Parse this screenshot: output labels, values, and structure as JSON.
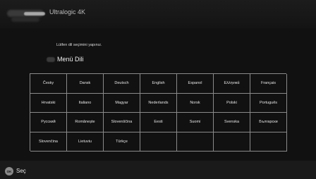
{
  "header": {
    "title": "Ultralogic 4K",
    "logo_icon": "brand-logo"
  },
  "prompt": "Lütfen dil seçimini yapınız.",
  "section": {
    "title": "Menü Dili",
    "icon": "menu-icon"
  },
  "languages": [
    [
      "Česky",
      "Dansk",
      "Deutsch",
      "English",
      "Espanol",
      "Ελληνικά",
      "Français"
    ],
    [
      "Hrvatski",
      "Italiano",
      "Magyar",
      "Nederlands",
      "Norsk",
      "Polski",
      "Português"
    ],
    [
      "Русский",
      "Românește",
      "Slovenščina",
      "Eesti",
      "Suomi",
      "Svenska",
      "Български"
    ],
    [
      "Slovenčina",
      "Lietuviu",
      "Türkçe",
      "",
      "",
      "",
      ""
    ]
  ],
  "footer": {
    "ok_button": "OK",
    "ok_label": "Seç"
  },
  "colors": {
    "background": "#111111",
    "grid_border": "#8a8a8a",
    "text": "#e6e6e6"
  }
}
